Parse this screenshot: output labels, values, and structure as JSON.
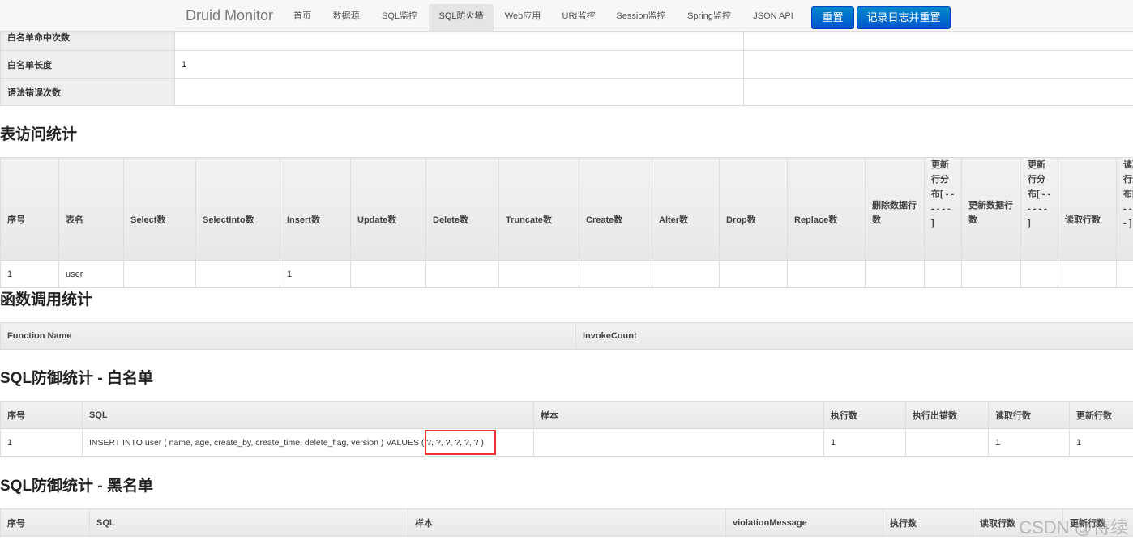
{
  "navbar": {
    "brand": "Druid Monitor",
    "items": [
      "首页",
      "数据源",
      "SQL监控",
      "SQL防火墙",
      "Web应用",
      "URI监控",
      "Session监控",
      "Spring监控",
      "JSON API"
    ],
    "active_item": "SQL防火墙",
    "reset_label": "重置",
    "log_reset_label": "记录日志并重置"
  },
  "whitelist_stats": [
    {
      "label": "白名单命中次数",
      "value": ""
    },
    {
      "label": "白名单长度",
      "value": "1"
    },
    {
      "label": "语法错误次数",
      "value": ""
    }
  ],
  "table_access": {
    "title": "表访问统计",
    "headers": [
      "序号",
      "表名",
      "Select数",
      "SelectInto数",
      "Insert数",
      "Update数",
      "Delete数",
      "Truncate数",
      "Create数",
      "Alter数",
      "Drop数",
      "Replace数",
      "删除数据行数",
      "更新行分布[ - - - - - - ]",
      "更新数据行数",
      "更新行分布[ - - - - - - ]",
      "读取行数",
      "读取行分布[ - - - - - - ]"
    ],
    "rows": [
      [
        "1",
        "user",
        "",
        "",
        "1",
        "",
        "",
        "",
        "",
        "",
        "",
        "",
        "",
        "",
        "",
        "",
        "",
        ""
      ]
    ]
  },
  "function_stats": {
    "title": "函数调用统计",
    "headers": [
      "Function Name",
      "InvokeCount"
    ]
  },
  "sql_whitelist": {
    "title": "SQL防御统计 - 白名单",
    "headers": [
      "序号",
      "SQL",
      "样本",
      "执行数",
      "执行出错数",
      "读取行数",
      "更新行数"
    ],
    "rows": [
      [
        "1",
        "INSERT INTO user ( name, age, create_by, create_time, delete_flag, version ) VALUES ( ?, ?, ?, ?, ?, ? )",
        "",
        "1",
        "",
        "1",
        "1"
      ]
    ]
  },
  "sql_blacklist": {
    "title": "SQL防御统计 - 黑名单",
    "headers": [
      "序号",
      "SQL",
      "样本",
      "violationMessage",
      "执行数",
      "读取行数",
      "更新行数"
    ]
  },
  "watermark": "CSDN @待续"
}
